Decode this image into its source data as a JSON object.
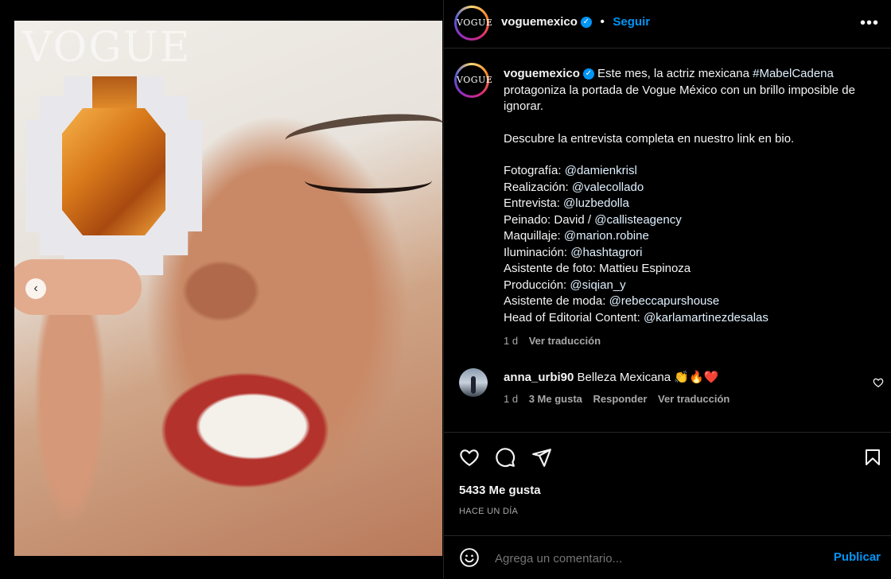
{
  "post": {
    "slides_count": 6,
    "active_slide": 6,
    "watermark": "VOGUE",
    "avatar_text": "VOGUE"
  },
  "header": {
    "username": "voguemexico",
    "separator": "•",
    "follow_label": "Seguir",
    "more_icon": "more-horizontal-icon"
  },
  "caption": {
    "username": "voguemexico",
    "text_before_tag": "Este mes, la actriz mexicana ",
    "hashtag": "#MabelCadena",
    "text_after_tag": " protagoniza la portada de Vogue México con un brillo imposible de ignorar.",
    "paragraph2": "Descubre la entrevista completa en nuestro link en bio.",
    "credits": [
      {
        "label": "Fotografía: ",
        "handle": "@damienkrisl"
      },
      {
        "label": "Realización: ",
        "handle": "@valecollado"
      },
      {
        "label": "Entrevista: ",
        "handle": "@luzbedolla"
      },
      {
        "label": "Peinado: David / ",
        "handle": "@callisteagency"
      },
      {
        "label": "Maquillaje: ",
        "handle": "@marion.robine"
      },
      {
        "label": "Iluminación: ",
        "handle": "@hashtagrori"
      },
      {
        "label": "Asistente de foto: Mattieu Espinoza",
        "handle": ""
      },
      {
        "label": "Producción: ",
        "handle": "@siqian_y"
      },
      {
        "label": "Asistente de moda: ",
        "handle": "@rebeccapurshouse"
      },
      {
        "label": "Head of Editorial Content: ",
        "handle": "@karlamartinezdesalas"
      }
    ],
    "time": "1 d",
    "translate": "Ver traducción"
  },
  "comment": {
    "username": "anna_urbi90",
    "text": "Belleza Mexicana 👏🔥❤️",
    "time": "1 d",
    "likes": "3 Me gusta",
    "reply": "Responder",
    "translate": "Ver traducción"
  },
  "actions": {
    "likes": "5433 Me gusta",
    "date": "HACE UN DÍA"
  },
  "composer": {
    "placeholder": "Agrega un comentario...",
    "publish": "Publicar"
  },
  "colors": {
    "accent": "#0095f6",
    "background": "#000000",
    "border": "#262626",
    "muted": "#a8a8a8"
  }
}
